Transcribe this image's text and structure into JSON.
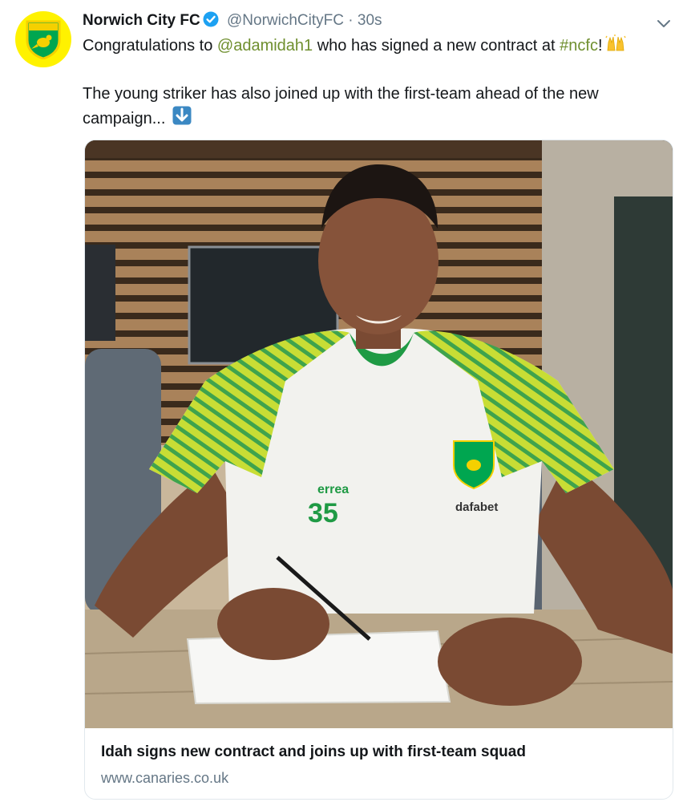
{
  "tweet": {
    "author_name": "Norwich City FC",
    "handle": "@NorwichCityFC",
    "separator": "·",
    "time": "30s",
    "line1_prefix": "Congratulations to ",
    "mention": "@adamidah1",
    "line1_middle": " who has signed a new contract at ",
    "hashtag": "#ncfc",
    "line1_suffix": "!",
    "line2": "The young striker has also joined up with the first-team ahead of the new campaign..."
  },
  "icons": {
    "avatar": "norwich-crest-icon",
    "verified": "verified-badge-icon",
    "menu": "chevron-down-icon",
    "emoji": "raised-hands-emoji",
    "arrow": "down-arrow-emoji"
  },
  "card": {
    "title": "Idah signs new contract and joins up with first-team squad",
    "url": "www.canaries.co.uk",
    "shirt_number": "35",
    "sponsor": "dafabet",
    "kit_brand": "errea"
  },
  "colors": {
    "link": "#6f8f2f",
    "verified": "#1da1f2",
    "avatar_bg": "#fff200",
    "club_green": "#00a650"
  }
}
